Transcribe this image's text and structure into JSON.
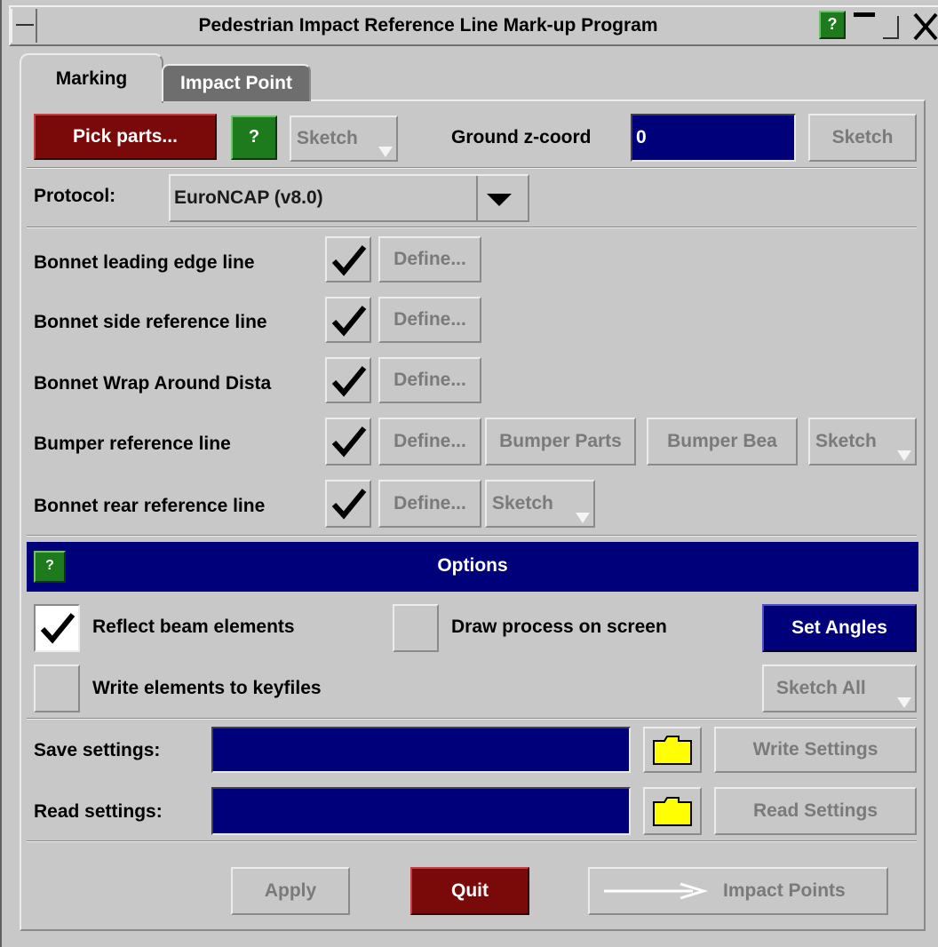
{
  "window": {
    "title": "Pedestrian Impact Reference Line Mark-up Program",
    "help_label": "?"
  },
  "tabs": [
    {
      "label": "Marking",
      "active": true
    },
    {
      "label": "Impact Point",
      "active": false
    }
  ],
  "toolbar": {
    "pick_parts_label": "Pick parts...",
    "help_label": "?",
    "sketch_label": "Sketch",
    "ground_label": "Ground z-coord",
    "ground_value": "0",
    "ground_sketch_label": "Sketch"
  },
  "protocol": {
    "label": "Protocol:",
    "selected": "EuroNCAP (v8.0)"
  },
  "lines": [
    {
      "label": "Bonnet leading edge line",
      "checked": true,
      "define_label": "Define..."
    },
    {
      "label": "Bonnet side reference line",
      "checked": true,
      "define_label": "Define..."
    },
    {
      "label": "Bonnet Wrap Around Dista",
      "checked": true,
      "define_label": "Define..."
    },
    {
      "label": "Bumper reference line",
      "checked": true,
      "define_label": "Define...",
      "extra": [
        "Bumper Parts",
        "Bumper Bea"
      ],
      "sketch_label": "Sketch"
    },
    {
      "label": "Bonnet rear reference line",
      "checked": true,
      "define_label": "Define...",
      "sketch_label": "Sketch"
    }
  ],
  "options": {
    "header": "Options",
    "help_label": "?",
    "reflect_label": "Reflect beam elements",
    "reflect_checked": true,
    "draw_label": "Draw process on screen",
    "draw_checked": false,
    "set_angles_label": "Set Angles",
    "write_label": "Write elements to keyfiles",
    "write_checked": false,
    "sketch_all_label": "Sketch All"
  },
  "settings": {
    "save_label": "Save settings:",
    "save_value": "",
    "write_button": "Write Settings",
    "read_label": "Read settings:",
    "read_value": "",
    "read_button": "Read Settings"
  },
  "footer": {
    "apply_label": "Apply",
    "quit_label": "Quit",
    "impact_points_label": "Impact Points"
  },
  "colors": {
    "panel": "#c8c8c8",
    "navy": "#00007a",
    "dark_red": "#7a0a0a",
    "help_green": "#1d7a1d",
    "folder_yellow": "#ffff00"
  }
}
